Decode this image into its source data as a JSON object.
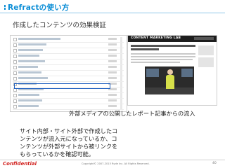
{
  "header": {
    "title": "Refractの使い方"
  },
  "subtitle": "作成したコンテンツの効果検証",
  "article": {
    "logo_text": "CONTENT MARKETING LAB"
  },
  "caption": "外部メディアの公開したレポート記事からの流入",
  "description": "サイト内部・サイト外部で作成したコンテンツが流入元になっているか、コンテンツが外部サイトから被リンクをもらっているかを確認可能。",
  "footer": {
    "confidential": "Confidential",
    "copyright": "Copyright© 2007-2015 Ryde Inc. All Rights Reserved.",
    "page_number": "40"
  }
}
